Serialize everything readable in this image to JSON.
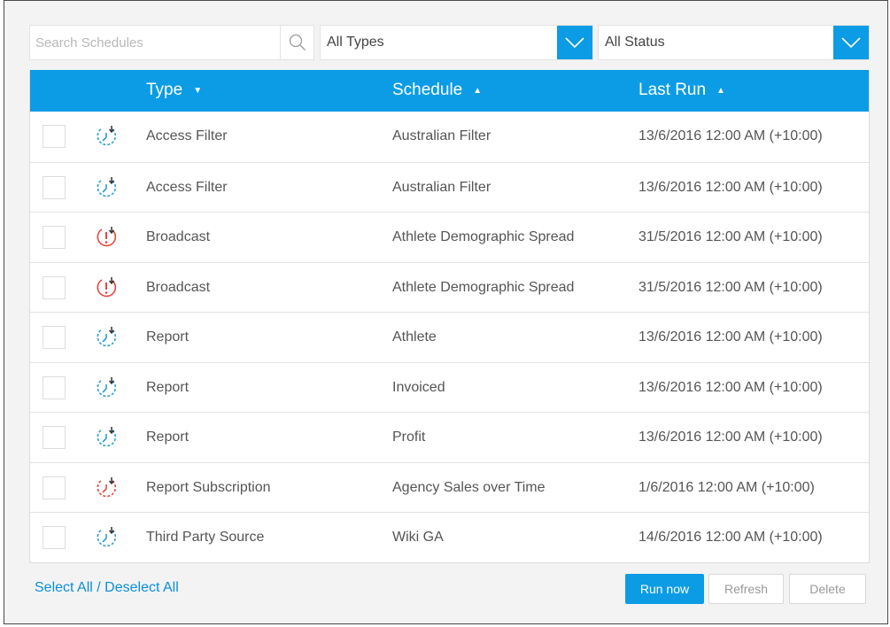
{
  "filters": {
    "search_placeholder": "Search Schedules",
    "type_value": "All Types",
    "status_value": "All Status"
  },
  "table": {
    "headers": {
      "type": "Type",
      "schedule": "Schedule",
      "last_run": "Last Run"
    },
    "rows": [
      {
        "icon": "schedule-clock-icon",
        "status": "ok",
        "type": "Access Filter",
        "schedule": "Australian Filter",
        "last_run": "13/6/2016 12:00 AM (+10:00)"
      },
      {
        "icon": "schedule-clock-icon",
        "status": "ok",
        "type": "Access Filter",
        "schedule": "Australian Filter",
        "last_run": "13/6/2016 12:00 AM (+10:00)"
      },
      {
        "icon": "schedule-error-icon",
        "status": "error",
        "type": "Broadcast",
        "schedule": "Athlete Demographic Spread",
        "last_run": "31/5/2016 12:00 AM (+10:00)"
      },
      {
        "icon": "schedule-error-icon",
        "status": "error",
        "type": "Broadcast",
        "schedule": "Athlete Demographic Spread",
        "last_run": "31/5/2016 12:00 AM (+10:00)"
      },
      {
        "icon": "schedule-clock-icon",
        "status": "ok",
        "type": "Report",
        "schedule": "Athlete",
        "last_run": "13/6/2016 12:00 AM (+10:00)"
      },
      {
        "icon": "schedule-clock-icon",
        "status": "ok",
        "type": "Report",
        "schedule": "Invoiced",
        "last_run": "13/6/2016 12:00 AM (+10:00)"
      },
      {
        "icon": "schedule-clock-icon",
        "status": "ok",
        "type": "Report",
        "schedule": "Profit",
        "last_run": "13/6/2016 12:00 AM (+10:00)"
      },
      {
        "icon": "schedule-clock-warning-icon",
        "status": "warning",
        "type": "Report Subscription",
        "schedule": "Agency Sales over Time",
        "last_run": "1/6/2016 12:00 AM (+10:00)"
      },
      {
        "icon": "schedule-clock-icon",
        "status": "ok",
        "type": "Third Party Source",
        "schedule": "Wiki GA",
        "last_run": "14/6/2016 12:00 AM (+10:00)"
      }
    ]
  },
  "footer": {
    "select_all": "Select All",
    "separator": " / ",
    "deselect_all": "Deselect All",
    "run_now": "Run now",
    "refresh": "Refresh",
    "delete": "Delete"
  },
  "colors": {
    "accent": "#0b9ce5",
    "ok_icon": "#2a9fd8",
    "error_icon": "#e8463c"
  }
}
